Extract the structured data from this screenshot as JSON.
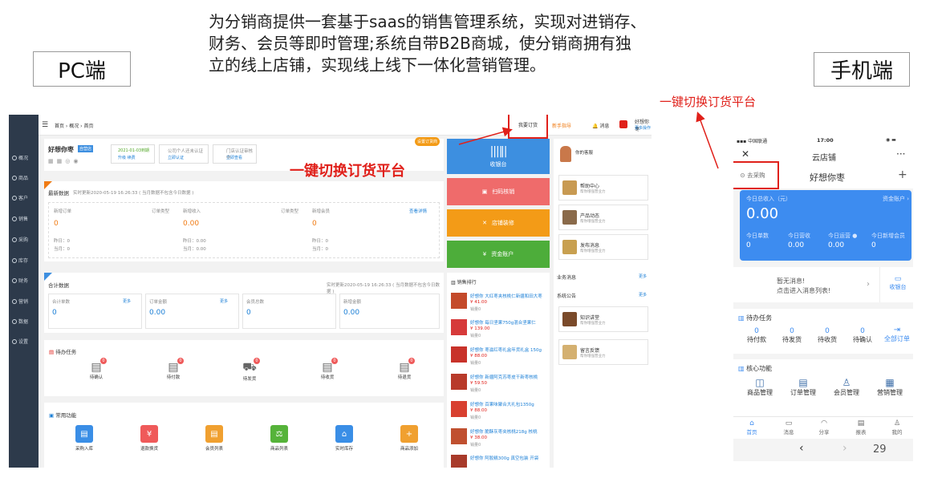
{
  "intro": {
    "line1": "为分销商提供一套基于saas的销售管理系统，实现对进销存、",
    "line2": "财务、会员等即时管理;系统自带B2B商城，使分销商拥有独",
    "line3": "立的线上店铺，实现线上线下一体化营销管理。"
  },
  "labels": {
    "pc": "PC端",
    "mobile": "手机端"
  },
  "callouts": {
    "pc_switch": "一键切换订货平台",
    "mobile_switch": "一键切换订货平台"
  },
  "pc": {
    "breadcrumb": [
      "首页",
      "概况",
      "首页"
    ],
    "top_actions": {
      "order": "我要订货",
      "guide": "新手指导",
      "msg": "消息",
      "user": "好想你枣",
      "more": "更多操作"
    },
    "sidebar": [
      "概况",
      "商品",
      "客户",
      "销售",
      "采购",
      "库存",
      "财务",
      "营销",
      "数据",
      "设置"
    ],
    "shop": {
      "name": "好想你枣",
      "badge": "自营店",
      "expire": "2021-01-03到期",
      "upgrade": "升级",
      "renew": "续费",
      "cert1": "公司个人还未认证",
      "cert1_link": "立即认证",
      "cert2": "门店认证审核中",
      "cert2_link": "立即查看",
      "flag": "设置订货商"
    },
    "new_data": {
      "title": "最新数据",
      "updated": "实时更新2020-05-19 16:26:33 ( 当月数据不包含今日数据 )",
      "more": "查看详情",
      "cols": [
        {
          "label": "新增订单",
          "type": "订单类型",
          "value": "0",
          "day": "昨日：0",
          "month": "当月：0"
        },
        {
          "label": "新增收入",
          "type": "订单类型",
          "value": "0.00",
          "day": "昨日：0.00",
          "month": "当月：0.00"
        },
        {
          "label": "新增会员",
          "type": "订单类型",
          "value": "0",
          "day": "昨日：0",
          "month": "当月：0"
        }
      ]
    },
    "totals": {
      "title": "合计数据",
      "updated": "实时更新2020-05-19 16:26:33 ( 当月数据不包含今日数据 )",
      "cols": [
        {
          "label": "合计单数",
          "more": "更多",
          "value": "0"
        },
        {
          "label": "订单金额",
          "more": "更多",
          "value": "0.00"
        },
        {
          "label": "会员总数",
          "more": "",
          "value": "0"
        },
        {
          "label": "新增金额",
          "more": "",
          "value": "0.00"
        }
      ]
    },
    "todo": {
      "title": "待办任务",
      "items": [
        {
          "label": "待确认",
          "badge": "0"
        },
        {
          "label": "待付款",
          "badge": "0"
        },
        {
          "label": "待发货",
          "badge": "0"
        },
        {
          "label": "待收货",
          "badge": "0"
        },
        {
          "label": "待退货",
          "badge": "0"
        }
      ]
    },
    "common": {
      "title": "常用功能",
      "items": [
        {
          "label": "采购入库",
          "color": "#3a8ee6"
        },
        {
          "label": "退款换货",
          "color": "#ef5a5a"
        },
        {
          "label": "会员列表",
          "color": "#f0a030"
        },
        {
          "label": "商品列表",
          "color": "#56b33a"
        },
        {
          "label": "实时库存",
          "color": "#3a8ee6"
        },
        {
          "label": "商品添加",
          "color": "#f0a030"
        }
      ]
    },
    "tiles": [
      {
        "label": "收银台",
        "color": "#3d8fe0"
      },
      {
        "label": "扫码核销",
        "color": "#ef6b6b"
      },
      {
        "label": "店铺装修",
        "color": "#f39b17"
      },
      {
        "label": "资金账户",
        "color": "#4dad3a"
      }
    ],
    "ranking": {
      "title": "销售排行",
      "items": [
        {
          "name": "好想你 大红枣夹核桃仁新疆和田大枣",
          "price": "¥ 41.00",
          "sold": "销量0"
        },
        {
          "name": "好想你 每日坚果750g混合坚果仁",
          "price": "¥ 139.00",
          "sold": "销量0"
        },
        {
          "name": "好想你 枣滋红枣礼盒年货礼盒 150g",
          "price": "¥ 88.00",
          "sold": "销量0"
        },
        {
          "name": "好想你 新疆阿克苏枣皮干新枣核桃",
          "price": "¥ 59.50",
          "sold": "销量0"
        },
        {
          "name": "好想你 百果味聚合大礼包1350g",
          "price": "¥ 88.00",
          "sold": "销量0"
        },
        {
          "name": "好想你 脆酥灰枣夹核桃218g 核桃",
          "price": "¥ 38.00",
          "sold": "销量0"
        },
        {
          "name": "好想你 阿胶糕300g 真空包装 开袋",
          "price": "",
          "sold": ""
        }
      ]
    },
    "right": {
      "adviser": "你的客服",
      "help": "帮助中心",
      "product": "产品动态",
      "publish": "发布消息",
      "sub": "帮你增强营业力",
      "biz": "业务消息",
      "notice": "系统公告",
      "more": "更多",
      "know": "知识讲堂",
      "feedback": "留言反馈"
    }
  },
  "mobile": {
    "status": {
      "carrier": "中国联通",
      "time": "17:00"
    },
    "title": "云店铺",
    "buy": "去采购",
    "shop": "好想你枣",
    "income_label": "今日总收入（元）",
    "income": "0.00",
    "account": "资金账户",
    "stats": [
      {
        "label": "今日单数",
        "value": "0"
      },
      {
        "label": "今日营收",
        "value": "0.00"
      },
      {
        "label": "今日运营",
        "value": "0.00"
      },
      {
        "label": "今日新增会员",
        "value": "0"
      }
    ],
    "msg": {
      "line1": "暂无消息!",
      "line2": "点击进入消息列表!",
      "cashier": "收银台"
    },
    "todo_title": "待办任务",
    "todo": [
      {
        "label": "待付款",
        "value": "0"
      },
      {
        "label": "待发货",
        "value": "0"
      },
      {
        "label": "待收货",
        "value": "0"
      },
      {
        "label": "待确认",
        "value": "0"
      }
    ],
    "all_orders": "全部订单",
    "core_title": "核心功能",
    "core": [
      "商品管理",
      "订单管理",
      "会员管理",
      "营销管理"
    ],
    "tabs": [
      "首页",
      "消息",
      "分享",
      "报表",
      "我的"
    ],
    "page": "29"
  }
}
